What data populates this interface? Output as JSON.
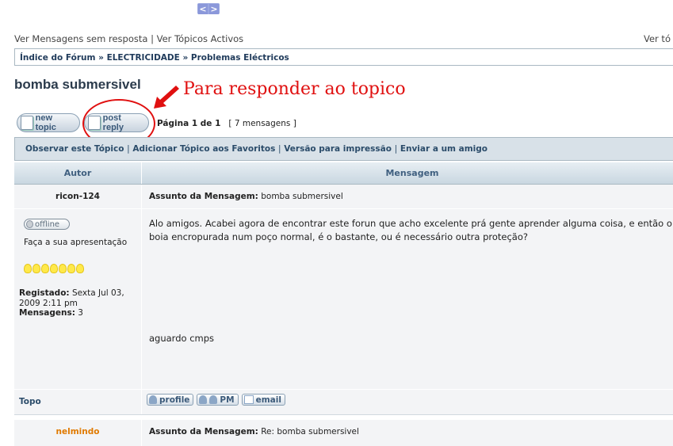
{
  "nav": {
    "prev": "<",
    "next": ">"
  },
  "quick_links": {
    "unanswered": "Ver Mensagens sem resposta",
    "separator": "|",
    "active": "Ver Tópicos Activos",
    "right": "Ver tó"
  },
  "breadcrumb": {
    "index": "Índice do Fórum",
    "sep": "»",
    "forum": "ELECTRICIDADE",
    "subforum": "Problemas Eléctricos"
  },
  "topic": {
    "title": "bomba submersivel"
  },
  "annotation": {
    "text": "Para responder ao topico",
    "color": "#e01010"
  },
  "buttons": {
    "new_topic": "new topic",
    "post_reply": "post reply"
  },
  "pagination": {
    "page_label": "Página 1 de 1",
    "count": "[ 7 mensagens ]"
  },
  "toolbar": {
    "watch": "Observar este Tópico",
    "favorites": "Adicionar Tópico aos Favoritos",
    "print": "Versão para impressão",
    "email_friend": "Enviar a um amigo",
    "sep": "|"
  },
  "table_header": {
    "author": "Autor",
    "message": "Mensagem"
  },
  "posts": [
    {
      "author": "ricon-124",
      "subject_label": "Assunto da Mensagem:",
      "subject": "bomba submersivel",
      "status": "offline",
      "rank": "Faça a sua apresentação",
      "registered_label": "Registado:",
      "registered": "Sexta Jul 03, 2009 2:11 pm",
      "posts_label": "Mensagens:",
      "posts_count": "3",
      "body_line1": "Alo amigos. Acabei agora de encontrar este forun que acho excelente prá gente aprender alguma coisa, e então o",
      "body_line2": "boia encropurada num poço normal, é o bastante, ou é necessário outra proteção?",
      "signature": "aguardo cmps",
      "topo": "Topo",
      "actions": {
        "profile": "profile",
        "pm": "PM",
        "email": "email"
      }
    },
    {
      "author": "nelmindo",
      "subject_label": "Assunto da Mensagem:",
      "subject": "Re: bomba submersivel"
    }
  ]
}
